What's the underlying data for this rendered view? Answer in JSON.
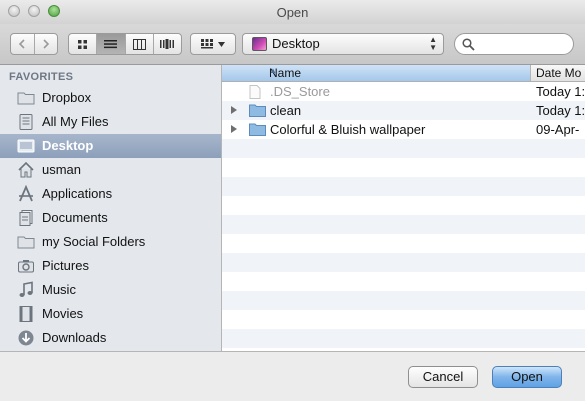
{
  "window": {
    "title": "Open"
  },
  "toolbar": {
    "location": "Desktop"
  },
  "sidebar": {
    "heading": "FAVORITES",
    "items": [
      {
        "label": "Dropbox",
        "icon": "folder-icon",
        "selected": false
      },
      {
        "label": "All My Files",
        "icon": "all-files-icon",
        "selected": false
      },
      {
        "label": "Desktop",
        "icon": "desktop-icon",
        "selected": true
      },
      {
        "label": "usman",
        "icon": "home-icon",
        "selected": false
      },
      {
        "label": "Applications",
        "icon": "applications-icon",
        "selected": false
      },
      {
        "label": "Documents",
        "icon": "documents-icon",
        "selected": false
      },
      {
        "label": "my Social Folders",
        "icon": "folder-icon",
        "selected": false
      },
      {
        "label": "Pictures",
        "icon": "camera-icon",
        "selected": false
      },
      {
        "label": "Music",
        "icon": "music-note-icon",
        "selected": false
      },
      {
        "label": "Movies",
        "icon": "film-icon",
        "selected": false
      },
      {
        "label": "Downloads",
        "icon": "download-icon",
        "selected": false
      }
    ]
  },
  "list": {
    "columns": {
      "name": "Name",
      "date": "Date Mo"
    },
    "rows": [
      {
        "name": ".DS_Store",
        "date": "Today 1:",
        "kind": "file",
        "dimmed": true
      },
      {
        "name": "clean",
        "date": "Today 1:",
        "kind": "folder",
        "dimmed": false
      },
      {
        "name": "Colorful & Bluish wallpaper",
        "date": "09-Apr-",
        "kind": "folder",
        "dimmed": false
      }
    ]
  },
  "buttons": {
    "cancel": "Cancel",
    "open": "Open"
  },
  "colors": {
    "sidebar_bg": "#e4e8ed",
    "selection": "#8d9fbb",
    "row_alt": "#f0f4f9",
    "default_button": "#5ea2e4",
    "folder": "#8fbbe3"
  }
}
